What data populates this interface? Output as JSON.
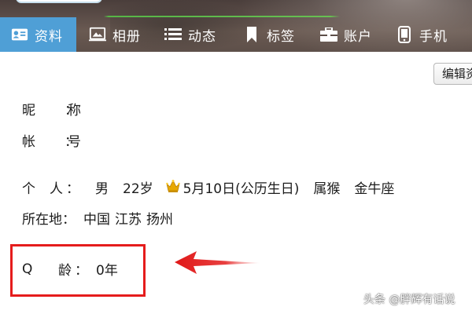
{
  "nav": {
    "tabs": [
      {
        "label": "资料",
        "icon": "profile-card-icon",
        "active": true
      },
      {
        "label": "相册",
        "icon": "photo-album-icon",
        "active": false
      },
      {
        "label": "动态",
        "icon": "list-feed-icon",
        "active": false
      },
      {
        "label": "标签",
        "icon": "bookmark-icon",
        "active": false
      },
      {
        "label": "账户",
        "icon": "briefcase-icon",
        "active": false
      },
      {
        "label": "手机",
        "icon": "mobile-phone-icon",
        "active": false
      }
    ]
  },
  "toolbar": {
    "edit_label": "编辑资料"
  },
  "profile": {
    "nickname_label_1": "昵",
    "nickname_label_2": "称",
    "nickname_colon": "：",
    "account_label_1": "帐",
    "account_label_2": "号",
    "account_colon": "：",
    "personal_label_1": "个",
    "personal_label_2": "人",
    "personal_colon": "：",
    "gender": "男",
    "age": "22岁",
    "birthday": "5月10日(公历生日)",
    "zodiac": "属猴",
    "constellation": "金牛座",
    "location_label": "所在地：",
    "location_country": "中国",
    "location_province": "江苏",
    "location_city": "扬州",
    "qage_label_1": "Q",
    "qage_label_2": "龄",
    "qage_colon": "：",
    "qage_value": "0年"
  },
  "watermark": "头条 @胖辉有话说",
  "colors": {
    "active_tab": "#4f9fd6",
    "highlight": "#e51c1c",
    "crown": "#e8a800"
  }
}
